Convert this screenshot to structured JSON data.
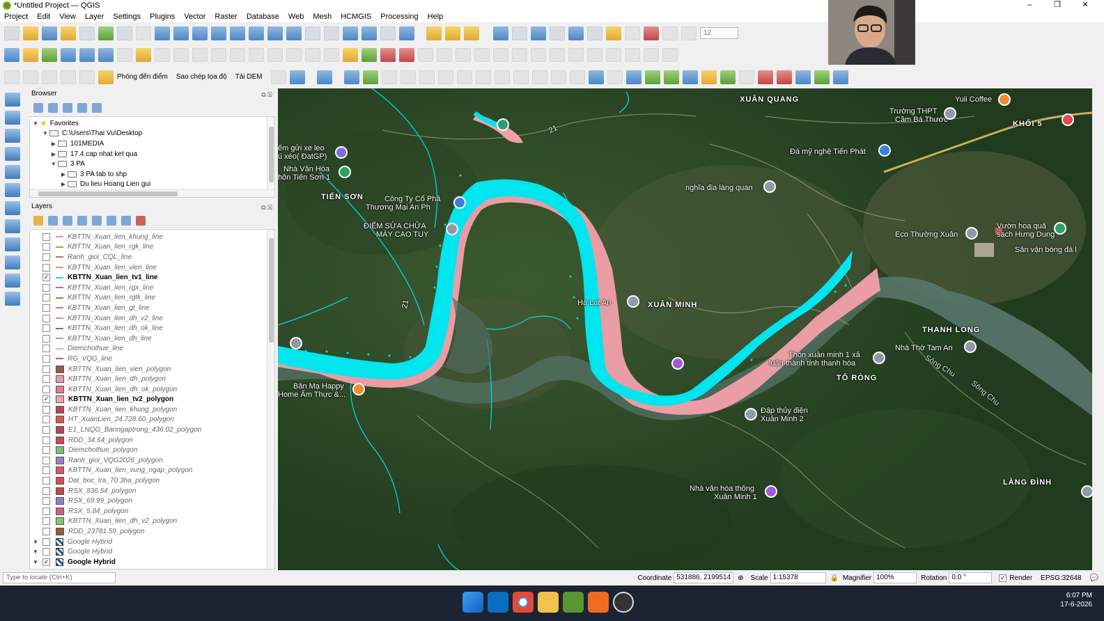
{
  "window": {
    "title": "*Untitled Project — QGIS",
    "min": "–",
    "max": "❐",
    "close": "✕"
  },
  "menu": [
    "Project",
    "Edit",
    "View",
    "Layer",
    "Settings",
    "Plugins",
    "Vector",
    "Raster",
    "Database",
    "Web",
    "Mesh",
    "HCMGIS",
    "Processing",
    "Help"
  ],
  "toolbar": {
    "scale_value": "12",
    "btn_phong": "Phóng đến điểm",
    "btn_saochep": "Sao chép tọa độ",
    "btn_taidem": "Tải DEM"
  },
  "browser": {
    "title": "Browser",
    "items": [
      {
        "label": "Favorites"
      },
      {
        "label": "C:\\Users\\Thai Vu\\Desktop"
      },
      {
        "label": "101MEDIA"
      },
      {
        "label": "17.4.cap nhat ket qua"
      },
      {
        "label": "3 PA"
      },
      {
        "label": "3 PA tab to shp"
      },
      {
        "label": "Du lieu Hoang Lien gui"
      }
    ]
  },
  "layers": {
    "title": "Layers",
    "items": [
      {
        "name": "KBTTN_Xuan_lien_khung_line",
        "type": "line",
        "color": "#c9a0a0",
        "checked": false
      },
      {
        "name": "KBTTN_Xuan_lien_rgk_line",
        "type": "line",
        "color": "#b89a60",
        "checked": false
      },
      {
        "name": "Ranh_gioi_CQL_line",
        "type": "line",
        "color": "#c76a6a",
        "checked": false
      },
      {
        "name": "KBTTN_Xuan_lien_vien_line",
        "type": "line",
        "color": "#d0a050",
        "checked": false
      },
      {
        "name": "KBTTN_Xuan_lien_tv1_line",
        "type": "line",
        "color": "#00e5ee",
        "checked": true
      },
      {
        "name": "KBTTN_Xuan_lien_rgx_line",
        "type": "line",
        "color": "#a070b0",
        "checked": false
      },
      {
        "name": "KBTTN_Xuan_lien_rgtk_line",
        "type": "line",
        "color": "#b07050",
        "checked": false
      },
      {
        "name": "KBTTN_Xuan_lien_gt_line",
        "type": "line",
        "color": "#c08080",
        "checked": false
      },
      {
        "name": "KBTTN_Xuan_lien_dh_v2_line",
        "type": "line",
        "color": "#c0a060",
        "checked": false
      },
      {
        "name": "KBTTN_Xuan_lien_dh_ok_line",
        "type": "line",
        "color": "#a06060",
        "checked": false
      },
      {
        "name": "KBTTN_Xuan_lien_dh_line",
        "type": "line",
        "color": "#d09090",
        "checked": false
      },
      {
        "name": "Diemchothue_line",
        "type": "line",
        "color": "#c0c0c0",
        "checked": false
      },
      {
        "name": "RG_VQG_line",
        "type": "line",
        "color": "#b06868",
        "checked": false
      },
      {
        "name": "KBTTN_Xuan_lien_vien_polygon",
        "type": "poly",
        "color": "#9b5a3a",
        "checked": false
      },
      {
        "name": "KBTTN_Xuan_lien_dh_polygon",
        "type": "poly",
        "color": "#e89aa8",
        "checked": false
      },
      {
        "name": "KBTTN_Xuan_lien_dh_ok_polygon",
        "type": "poly",
        "color": "#e57a90",
        "checked": false
      },
      {
        "name": "KBTTN_Xuan_lien_tv2_polygon",
        "type": "poly",
        "color": "#f2a0aa",
        "checked": true
      },
      {
        "name": "KBTTN_Xuan_lien_khung_polygon",
        "type": "poly",
        "color": "#c0444a",
        "checked": false
      },
      {
        "name": "HT_XuanLien_24.728.60_polygon",
        "type": "poly",
        "color": "#d65858",
        "checked": false
      },
      {
        "name": "E1_LNQG_Banngaptrong_436.02_polygon",
        "type": "poly",
        "color": "#b9414e",
        "checked": false
      },
      {
        "name": "RDD_34.64_polygon",
        "type": "poly",
        "color": "#c94b4b",
        "checked": false
      },
      {
        "name": "Diemchothue_polygon",
        "type": "poly",
        "color": "#7cc47c",
        "checked": false
      },
      {
        "name": "Ranh_gioi_VQG2026_polygon",
        "type": "poly",
        "color": "#9f7fc6",
        "checked": false
      },
      {
        "name": "KBTTN_Xuan_lien_vung_ngap_polygon",
        "type": "poly",
        "color": "#d9556a",
        "checked": false
      },
      {
        "name": "Dat_boc_tra_70.3ha_polygon",
        "type": "poly",
        "color": "#d94a5a",
        "checked": false
      },
      {
        "name": "RSX_836.54_polygon",
        "type": "poly",
        "color": "#c24848",
        "checked": false
      },
      {
        "name": "RSX_69.99_polygon",
        "type": "poly",
        "color": "#8f7fd0",
        "checked": false
      },
      {
        "name": "RSX_5.84_polygon",
        "type": "poly",
        "color": "#e05a7a",
        "checked": false
      },
      {
        "name": "KBTTN_Xuan_lien_dh_v2_polygon",
        "type": "poly",
        "color": "#86c46c",
        "checked": false
      },
      {
        "name": "RDD_23781.59_polygon",
        "type": "poly",
        "color": "#9b5a3a",
        "checked": false
      },
      {
        "name": "Google Hybrid",
        "type": "raster",
        "color": "#2a5a8a",
        "checked": false
      },
      {
        "name": "Google Hybrid",
        "type": "raster",
        "color": "#2a5a8a",
        "checked": false
      },
      {
        "name": "Google Hybrid",
        "type": "raster",
        "color": "#2a5a8a",
        "checked": true
      }
    ]
  },
  "map": {
    "labels": [
      {
        "text": "XUÂN QUANG",
        "place": true
      },
      {
        "text": "Yuli Coffee",
        "place": false
      },
      {
        "text": "Trường THPT",
        "place": false
      },
      {
        "text": "Cầm Bá Thước",
        "place": false
      },
      {
        "text": "KHỐI 5",
        "place": true
      },
      {
        "text": "Đá mỹ nghệ Tiến Phát",
        "place": false
      },
      {
        "text": "nghĩa địa làng quan",
        "place": false
      },
      {
        "text": "ếm gửi xe leo",
        "place": false
      },
      {
        "text": "ú xéo( ĐatGP)",
        "place": false
      },
      {
        "text": "Nhà Văn Hóa",
        "place": false
      },
      {
        "text": "hôn Tiến Sơn 1",
        "place": false
      },
      {
        "text": "TIẾN SƠN",
        "place": true
      },
      {
        "text": "Công Ty Cổ Phầ",
        "place": false
      },
      {
        "text": "Thương Mại An Ph",
        "place": false
      },
      {
        "text": "ĐIỂM SỬA CHỮA",
        "place": false
      },
      {
        "text": "MÁY CẠO TUY",
        "place": false
      },
      {
        "text": "Eco Thường Xuân",
        "place": false
      },
      {
        "text": "Vườn hoa quả",
        "place": false
      },
      {
        "text": "sạch Hưng Dung",
        "place": false
      },
      {
        "text": "Sân vận bóng đá l",
        "place": false
      },
      {
        "text": "Hà Lạt An",
        "place": false
      },
      {
        "text": "XUÂN MINH",
        "place": true
      },
      {
        "text": "THANH LONG",
        "place": true
      },
      {
        "text": "Nhà Thờ Tam An",
        "place": false
      },
      {
        "text": "Thôn xuân minh 1 xã",
        "place": false
      },
      {
        "text": "luân thành tỉnh thanh hóa",
        "place": false
      },
      {
        "text": "TỐ RÒNG",
        "place": true
      },
      {
        "text": "Bản Mạ Happy",
        "place": false
      },
      {
        "text": "Home Ẩm Thực &...",
        "place": false
      },
      {
        "text": "Đập thủy điện",
        "place": false
      },
      {
        "text": "Xuân Minh 2",
        "place": false
      },
      {
        "text": "Nhà văn hóa thông",
        "place": false
      },
      {
        "text": "Xuân Minh 1",
        "place": false
      },
      {
        "text": "LÀNG ĐÌNH",
        "place": true
      },
      {
        "text": "Sông Chu",
        "place": false
      },
      {
        "text": "Sông Chu",
        "place": false
      },
      {
        "text": "21",
        "place": false
      },
      {
        "text": "21",
        "place": false
      }
    ]
  },
  "status": {
    "locator_placeholder": "Type to locate (Ctrl+K)",
    "coordinate_label": "Coordinate",
    "coordinate_value": "531886, 2199514",
    "scale_label": "Scale",
    "scale_value": "1:15378",
    "magnifier_label": "Magnifier",
    "magnifier_value": "100%",
    "rotation_label": "Rotation",
    "rotation_value": "0.0 °",
    "render_label": "Render",
    "crs": "EPSG:32648"
  },
  "taskbar": {
    "time": "6:07 PM",
    "date": "17-6-2026"
  }
}
